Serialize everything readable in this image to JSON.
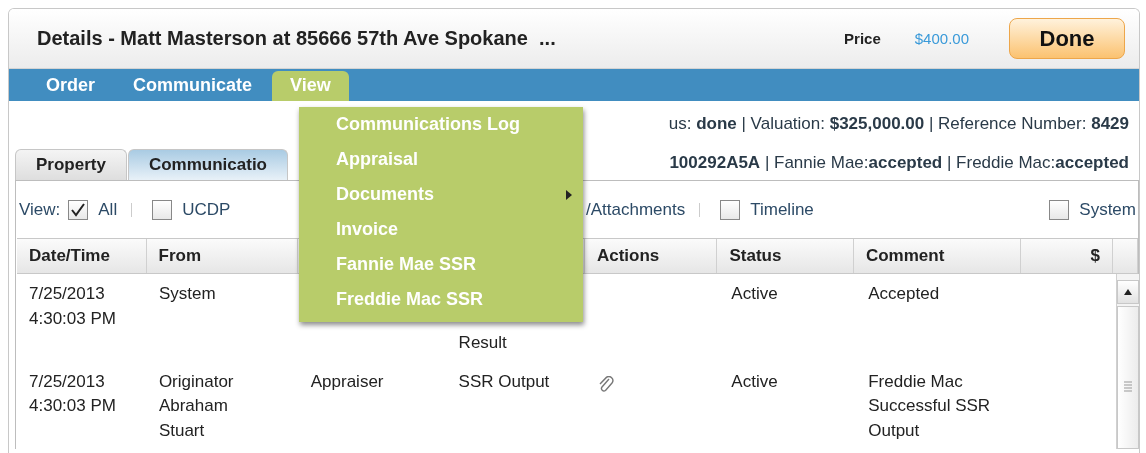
{
  "window": {
    "title": "Details - Matt Masterson at 85666 57th Ave Spokane  ...",
    "price_label": "Price",
    "price": "$400.00",
    "done_button": "Done"
  },
  "menubar": {
    "items": [
      {
        "label": "Order",
        "selected": false
      },
      {
        "label": "Communicate",
        "selected": false
      },
      {
        "label": "View",
        "selected": true
      }
    ]
  },
  "view_menu": {
    "items": [
      {
        "label": "Communications Log",
        "submenu": false
      },
      {
        "label": "Appraisal",
        "submenu": false
      },
      {
        "label": "Documents",
        "submenu": true
      },
      {
        "label": "Invoice",
        "submenu": false
      },
      {
        "label": "Fannie Mae SSR",
        "submenu": false
      },
      {
        "label": "Freddie Mac SSR",
        "submenu": false
      }
    ]
  },
  "summary": {
    "line_1": "us: **done** | Valuation: **$325,000.00** | Reference Number: **8429**",
    "line_2": "**100292A5A** | Fannie Mae:**accepted** | Freddie Mac:**accepted**"
  },
  "tabs": [
    {
      "label": "Property",
      "selected": false
    },
    {
      "label": "Communicatio",
      "selected": true
    }
  ],
  "filters": {
    "label": "View:",
    "items": [
      {
        "label": "All",
        "kind": "checkbox",
        "checked": true
      },
      {
        "label": "UCDP",
        "kind": "checkbox",
        "checked": false
      },
      {
        "label": "/Attachments",
        "kind": "text"
      },
      {
        "label": "Timeline",
        "kind": "checkbox",
        "checked": false
      },
      {
        "label": "System",
        "kind": "checkbox",
        "checked": false
      }
    ]
  },
  "table": {
    "columns": [
      "Date/Time",
      "From",
      null,
      null,
      "Actions",
      "Status",
      "Comment",
      "$"
    ],
    "rows": [
      {
        "cells": [
          "7/25/2013\n4:30:03 PM",
          "System",
          null,
          "Result",
          null,
          "Active",
          "Accepted",
          null
        ],
        "attachment": false
      },
      {
        "cells": [
          "7/25/2013\n4:30:03 PM",
          "Originator\nAbraham\nStuart",
          "Appraiser",
          "SSR Output",
          null,
          "Active",
          "Freddie Mac\nSuccessful SSR\nOutput",
          null
        ],
        "attachment": true
      }
    ]
  }
}
